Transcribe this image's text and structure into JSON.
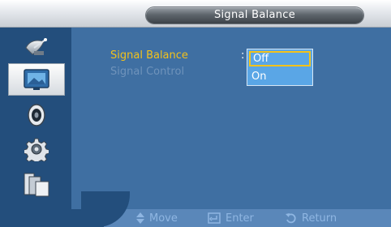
{
  "header": {
    "title": "Signal Balance"
  },
  "sidebar": {
    "items": [
      {
        "icon": "satellite-dish-icon",
        "selected": false
      },
      {
        "icon": "picture-icon",
        "selected": true
      },
      {
        "icon": "speaker-icon",
        "selected": false
      },
      {
        "icon": "gear-icon",
        "selected": false
      },
      {
        "icon": "multi-screen-icon",
        "selected": false
      }
    ]
  },
  "menu": {
    "items": [
      {
        "label": "Signal Balance",
        "state": "active"
      },
      {
        "label": "Signal Control",
        "state": "inactive"
      }
    ],
    "separator": ":"
  },
  "dropdown": {
    "options": [
      {
        "label": "Off",
        "selected": true
      },
      {
        "label": "On",
        "selected": false
      }
    ]
  },
  "footer": {
    "move": "Move",
    "enter": "Enter",
    "return": "Return"
  },
  "colors": {
    "panel": "#3f6fa2",
    "sidebar": "#234e7c",
    "highlight": "#f3c21a",
    "dropdown": "#5aa6e6"
  }
}
